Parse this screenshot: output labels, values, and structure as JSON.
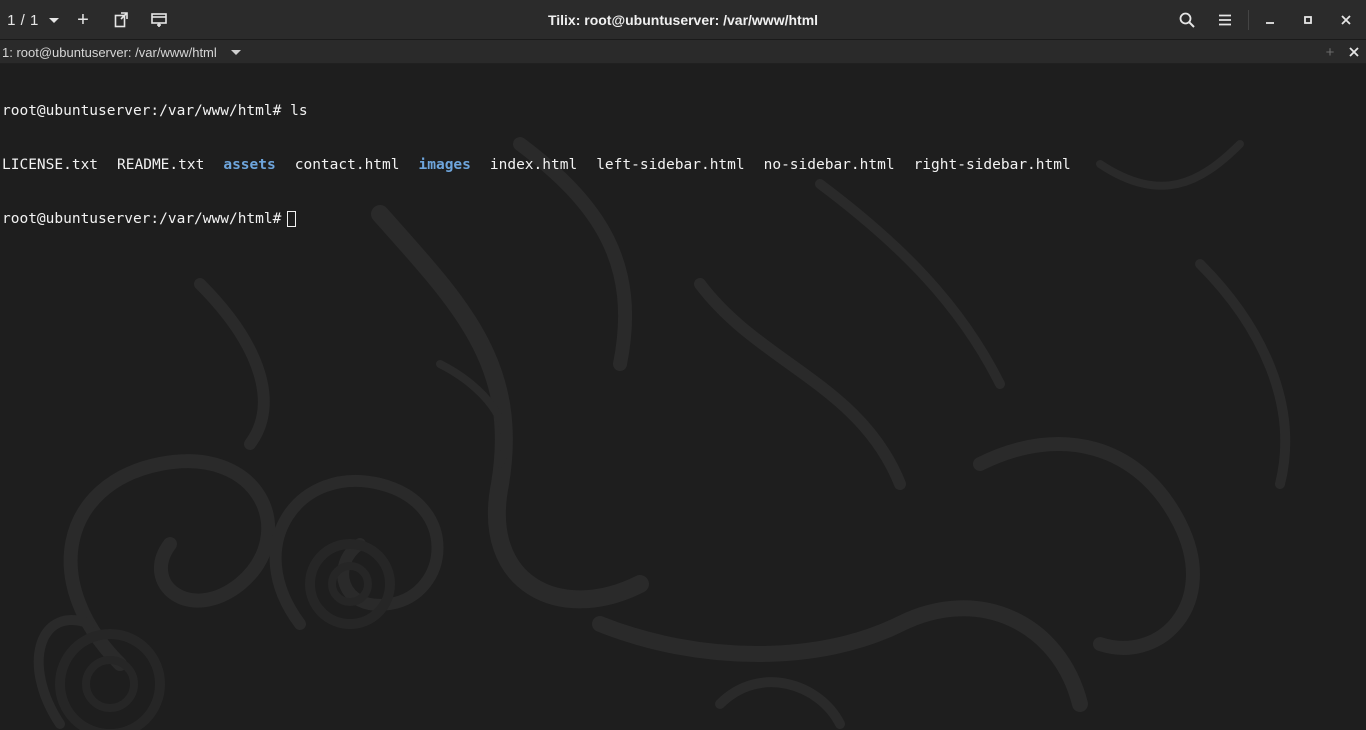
{
  "app": {
    "title": "Tilix: root@ubuntuserver: /var/www/html",
    "session_counter": "1 / 1"
  },
  "headerbar": {
    "icons": [
      "add-icon",
      "detach-icon",
      "sync-input-icon",
      "search-icon",
      "hamburger-menu-icon",
      "minimize-icon",
      "maximize-icon",
      "close-icon"
    ],
    "plus_glyph": "+"
  },
  "terminal_tab": {
    "title": "1: root@ubuntuserver: /var/www/html",
    "add_glyph": "+"
  },
  "terminal": {
    "prompt": "root@ubuntuserver:/var/www/html#",
    "command": "ls",
    "listing": [
      {
        "name": "LICENSE.txt",
        "type": "file"
      },
      {
        "name": "README.txt",
        "type": "file"
      },
      {
        "name": "assets",
        "type": "dir"
      },
      {
        "name": "contact.html",
        "type": "file"
      },
      {
        "name": "images",
        "type": "dir"
      },
      {
        "name": "index.html",
        "type": "file"
      },
      {
        "name": "left-sidebar.html",
        "type": "file"
      },
      {
        "name": "no-sidebar.html",
        "type": "file"
      },
      {
        "name": "right-sidebar.html",
        "type": "file"
      }
    ],
    "colors": {
      "text": "#f2f2f2",
      "directory": "#6ea5dc",
      "background": "#1e1e1e"
    }
  }
}
